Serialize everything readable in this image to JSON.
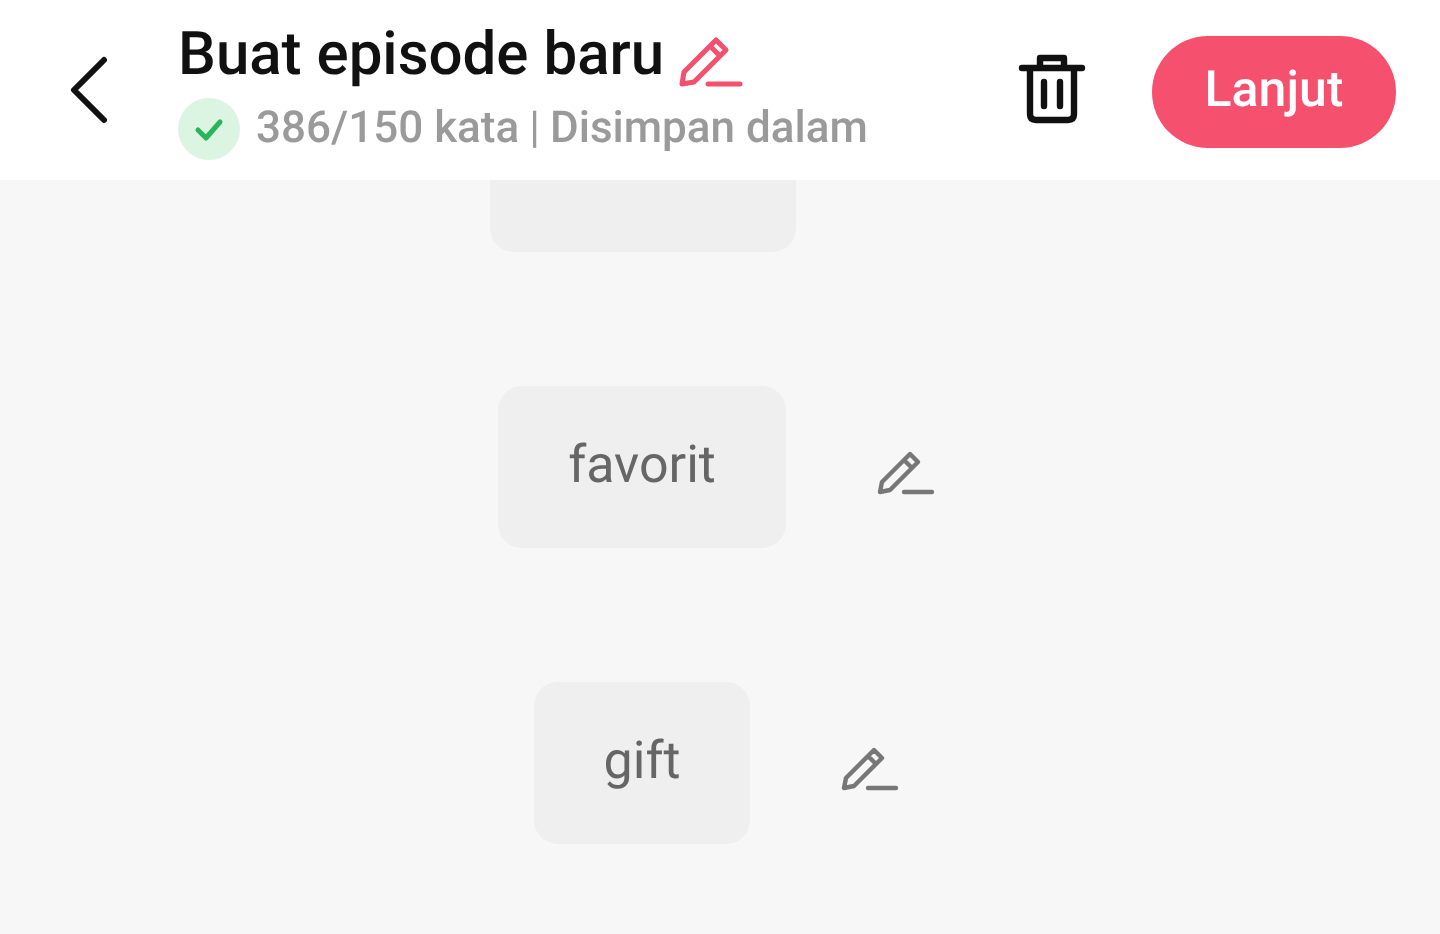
{
  "header": {
    "title": "Buat episode baru",
    "word_count": "386/150 kata",
    "separator": "|",
    "save_status": "Disimpan dalam",
    "next_button": "Lanjut"
  },
  "items": [
    {
      "label": "favorit",
      "editable": true
    },
    {
      "label": "gift",
      "editable": true
    }
  ]
}
